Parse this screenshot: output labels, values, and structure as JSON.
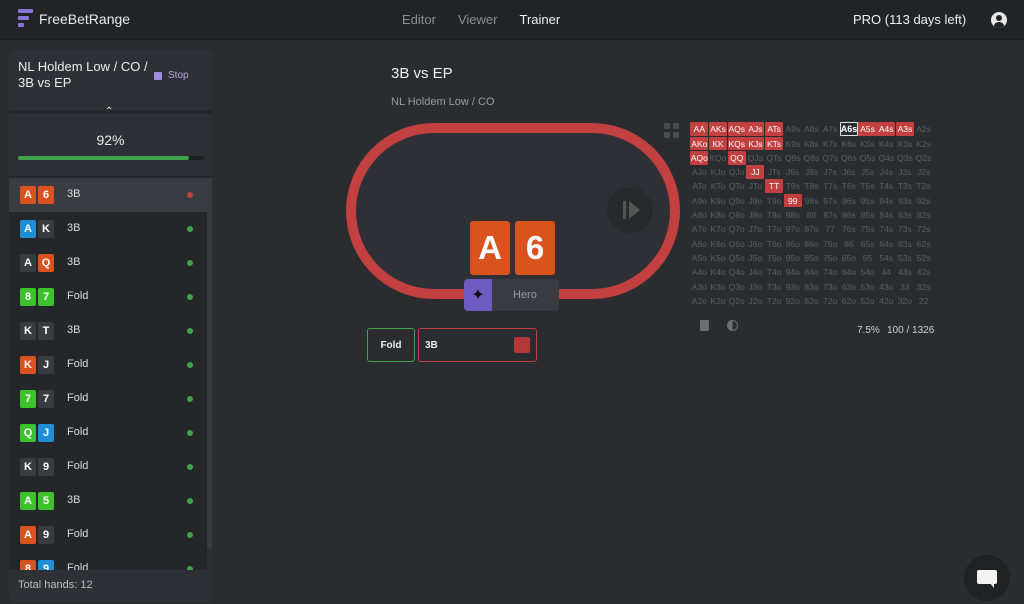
{
  "header": {
    "logo": "FreeBetRange",
    "nav": [
      "Editor",
      "Viewer",
      "Trainer"
    ],
    "active_nav": "Trainer",
    "pro_status": "PRO (113 days left)"
  },
  "sidebar": {
    "title": "NL Holdem Low / CO / 3B vs EP",
    "stop_label": "Stop",
    "percent_label": "92%",
    "progress": 0.92,
    "footer": "Total hands: 12",
    "hands": [
      {
        "cards": [
          {
            "r": "A",
            "c": "#d8531d"
          },
          {
            "r": "6",
            "c": "#d8531d"
          }
        ],
        "action": "3B",
        "status": "#c2403f",
        "selected": true
      },
      {
        "cards": [
          {
            "r": "A",
            "c": "#1e8fd6"
          },
          {
            "r": "K",
            "c": "#3a3b40"
          }
        ],
        "action": "3B",
        "status": "#3fa34d"
      },
      {
        "cards": [
          {
            "r": "A",
            "c": "#3a3b40"
          },
          {
            "r": "Q",
            "c": "#d8531d"
          }
        ],
        "action": "3B",
        "status": "#3fa34d"
      },
      {
        "cards": [
          {
            "r": "8",
            "c": "#3ec22b"
          },
          {
            "r": "7",
            "c": "#3ec22b"
          }
        ],
        "action": "Fold",
        "status": "#3fa34d"
      },
      {
        "cards": [
          {
            "r": "K",
            "c": "#3a3b40"
          },
          {
            "r": "T",
            "c": "#3a3b40"
          }
        ],
        "action": "3B",
        "status": "#3fa34d"
      },
      {
        "cards": [
          {
            "r": "K",
            "c": "#d8531d"
          },
          {
            "r": "J",
            "c": "#3a3b40"
          }
        ],
        "action": "Fold",
        "status": "#3fa34d"
      },
      {
        "cards": [
          {
            "r": "7",
            "c": "#3ec22b"
          },
          {
            "r": "7",
            "c": "#3a3b40"
          }
        ],
        "action": "Fold",
        "status": "#3fa34d"
      },
      {
        "cards": [
          {
            "r": "Q",
            "c": "#3ec22b"
          },
          {
            "r": "J",
            "c": "#1e8fd6"
          }
        ],
        "action": "Fold",
        "status": "#3fa34d"
      },
      {
        "cards": [
          {
            "r": "K",
            "c": "#3a3b40"
          },
          {
            "r": "9",
            "c": "#3a3b40"
          }
        ],
        "action": "Fold",
        "status": "#3fa34d"
      },
      {
        "cards": [
          {
            "r": "A",
            "c": "#3ec22b"
          },
          {
            "r": "5",
            "c": "#3ec22b"
          }
        ],
        "action": "3B",
        "status": "#3fa34d"
      },
      {
        "cards": [
          {
            "r": "A",
            "c": "#d8531d"
          },
          {
            "r": "9",
            "c": "#3a3b40"
          }
        ],
        "action": "Fold",
        "status": "#3fa34d"
      },
      {
        "cards": [
          {
            "r": "8",
            "c": "#d8531d"
          },
          {
            "r": "9",
            "c": "#1e8fd6"
          }
        ],
        "action": "Fold",
        "status": "#3fa34d"
      }
    ]
  },
  "main": {
    "title": "3B vs EP",
    "subtitle": "NL Holdem Low / CO",
    "hero_cards": [
      "A",
      "6"
    ],
    "hero_label": "Hero",
    "actions": {
      "fold": "Fold",
      "threebet": "3B"
    }
  },
  "range": {
    "highlighted": [
      "AA",
      "AKs",
      "AQs",
      "AJs",
      "ATs",
      "A5s",
      "A4s",
      "A3s",
      "AKo",
      "KK",
      "KQs",
      "KJs",
      "KTs",
      "AQo",
      "QQ",
      "JJ",
      "TT",
      "99"
    ],
    "current": "A6s",
    "percent": "7.5%",
    "count": "100 / 1326"
  },
  "colors": {
    "accent": "#8b73d8",
    "raise": "#c2403f",
    "ok": "#3fa34d"
  }
}
